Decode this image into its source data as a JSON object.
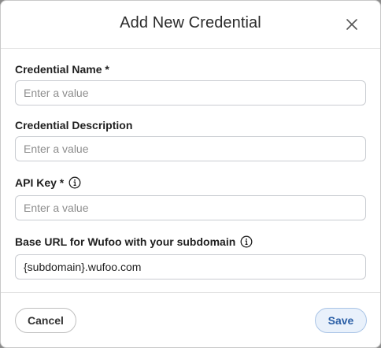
{
  "dialog": {
    "title": "Add New Credential"
  },
  "fields": {
    "credential_name": {
      "label": "Credential Name *",
      "value": "",
      "placeholder": "Enter a value"
    },
    "credential_description": {
      "label": "Credential Description",
      "value": "",
      "placeholder": "Enter a value"
    },
    "api_key": {
      "label": "API Key *",
      "value": "",
      "placeholder": "Enter a value",
      "info_icon": "info-icon"
    },
    "base_url": {
      "label": "Base URL for Wufoo with your subdomain",
      "value": "{subdomain}.wufoo.com",
      "placeholder": "",
      "info_icon": "info-icon"
    }
  },
  "footer": {
    "cancel_label": "Cancel",
    "save_label": "Save"
  },
  "colors": {
    "save_bg": "#e9f1fb",
    "save_border": "#a9c4e6",
    "save_text": "#2b5fa6"
  }
}
